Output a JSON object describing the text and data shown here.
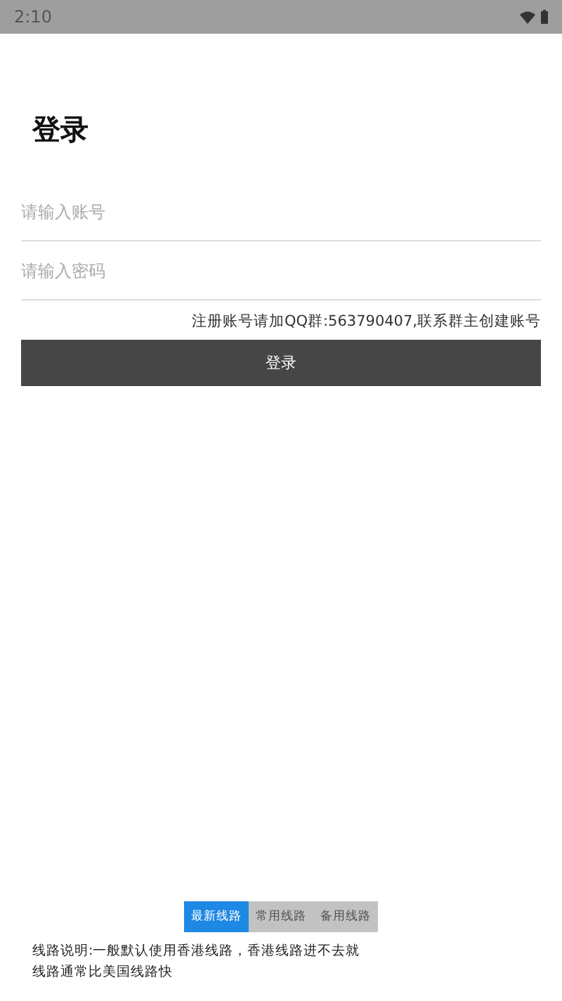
{
  "status_bar": {
    "time": "2:10"
  },
  "title": "登录",
  "fields": [
    {
      "placeholder": "请输入账号"
    },
    {
      "placeholder": "请输入密码"
    }
  ],
  "note": "注册账号请加QQ群:563790407,联系群主创建账号",
  "login_button": "登录",
  "route_tabs": [
    {
      "label": "最新线路",
      "selected": true
    },
    {
      "label": "常用线路",
      "selected": false
    },
    {
      "label": "备用线路",
      "selected": false
    }
  ],
  "description_lines": [
    "线路说明:一般默认使用香港线路，香港线路进不去就",
    "线路通常比美国线路快"
  ]
}
